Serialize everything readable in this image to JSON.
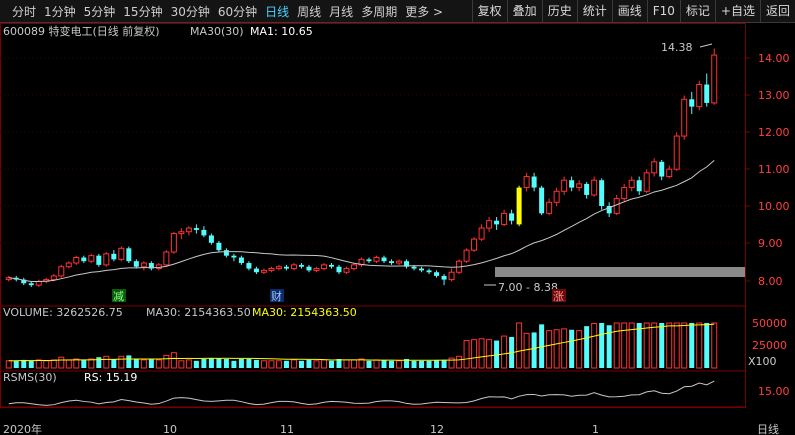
{
  "toolbar": {
    "periods": [
      "分时",
      "1分钟",
      "5分钟",
      "15分钟",
      "30分钟",
      "60分钟",
      "日线",
      "周线",
      "月线",
      "多周期",
      "更多 >"
    ],
    "active_period": "日线",
    "buttons": [
      "复权",
      "叠加",
      "历史",
      "统计",
      "画线",
      "F10",
      "标记",
      "+自选",
      "返回"
    ]
  },
  "stock": {
    "header": "600089 特变电工(日线 前复权)",
    "ma_label": "MA30(30)",
    "ma_value": "MA1: 10.65",
    "max_label": "14.38",
    "min_label": "7.00 - 8.38",
    "price_ticks": [
      "14.00",
      "13.00",
      "12.00",
      "11.00",
      "10.00",
      "9.00",
      "8.00"
    ]
  },
  "markers": {
    "reduce": "减",
    "finance": "财",
    "rise": "涨"
  },
  "volume": {
    "header": "VOLUME: 3262526.75",
    "ma30_1": "MA30: 2154363.50",
    "ma30_2": "MA30: 2154363.50",
    "ticks": [
      "50000",
      "25000"
    ],
    "unit": "X100"
  },
  "rsms": {
    "header": "RSMS(30)",
    "value": "RS: 15.19",
    "tick": "15.00"
  },
  "xaxis": {
    "labels": [
      "2020年",
      "10",
      "11",
      "12",
      "1"
    ],
    "right_label": "日线"
  },
  "colors": {
    "up": "#ff3232",
    "down": "#54fcfc",
    "highlight": "#ffff00",
    "ma": "#c8c8c8",
    "grid": "#7a0000"
  },
  "chart_data": {
    "type": "candlestick",
    "ylim": [
      7.6,
      14.8
    ],
    "candles": [
      [
        8.1,
        8.15,
        8.05,
        8.2
      ],
      [
        8.15,
        8.1,
        8.05,
        8.2
      ],
      [
        8.1,
        8.0,
        7.95,
        8.15
      ],
      [
        8.0,
        7.95,
        7.9,
        8.05
      ],
      [
        7.95,
        8.05,
        7.9,
        8.1
      ],
      [
        8.05,
        8.1,
        8.0,
        8.15
      ],
      [
        8.1,
        8.2,
        8.05,
        8.25
      ],
      [
        8.2,
        8.45,
        8.15,
        8.5
      ],
      [
        8.45,
        8.55,
        8.4,
        8.6
      ],
      [
        8.55,
        8.7,
        8.5,
        8.75
      ],
      [
        8.7,
        8.6,
        8.55,
        8.75
      ],
      [
        8.6,
        8.75,
        8.55,
        8.8
      ],
      [
        8.75,
        8.5,
        8.45,
        8.8
      ],
      [
        8.5,
        8.8,
        8.45,
        8.85
      ],
      [
        8.8,
        8.65,
        8.6,
        8.9
      ],
      [
        8.65,
        8.95,
        8.6,
        9.0
      ],
      [
        8.95,
        8.6,
        8.55,
        9.0
      ],
      [
        8.6,
        8.45,
        8.4,
        8.65
      ],
      [
        8.45,
        8.55,
        8.35,
        8.6
      ],
      [
        8.55,
        8.4,
        8.35,
        8.6
      ],
      [
        8.4,
        8.5,
        8.35,
        8.55
      ],
      [
        8.5,
        8.85,
        8.45,
        8.9
      ],
      [
        8.85,
        9.35,
        8.8,
        9.4
      ],
      [
        9.35,
        9.4,
        9.2,
        9.5
      ],
      [
        9.4,
        9.5,
        9.3,
        9.55
      ],
      [
        9.5,
        9.45,
        9.35,
        9.6
      ],
      [
        9.45,
        9.3,
        9.25,
        9.55
      ],
      [
        9.3,
        9.1,
        9.05,
        9.35
      ],
      [
        9.1,
        8.9,
        8.85,
        9.15
      ],
      [
        8.9,
        8.75,
        8.7,
        8.95
      ],
      [
        8.75,
        8.7,
        8.6,
        8.8
      ],
      [
        8.7,
        8.55,
        8.5,
        8.75
      ],
      [
        8.55,
        8.4,
        8.35,
        8.6
      ],
      [
        8.4,
        8.3,
        8.25,
        8.45
      ],
      [
        8.3,
        8.35,
        8.25,
        8.4
      ],
      [
        8.35,
        8.4,
        8.3,
        8.45
      ],
      [
        8.4,
        8.45,
        8.35,
        8.5
      ],
      [
        8.45,
        8.4,
        8.35,
        8.5
      ],
      [
        8.4,
        8.5,
        8.35,
        8.55
      ],
      [
        8.5,
        8.45,
        8.4,
        8.55
      ],
      [
        8.45,
        8.35,
        8.3,
        8.5
      ],
      [
        8.35,
        8.4,
        8.3,
        8.45
      ],
      [
        8.4,
        8.5,
        8.35,
        8.55
      ],
      [
        8.5,
        8.45,
        8.4,
        8.55
      ],
      [
        8.45,
        8.3,
        8.25,
        8.5
      ],
      [
        8.3,
        8.4,
        8.25,
        8.45
      ],
      [
        8.4,
        8.5,
        8.35,
        8.55
      ],
      [
        8.5,
        8.65,
        8.45,
        8.7
      ],
      [
        8.65,
        8.6,
        8.55,
        8.7
      ],
      [
        8.6,
        8.7,
        8.55,
        8.75
      ],
      [
        8.7,
        8.6,
        8.55,
        8.75
      ],
      [
        8.6,
        8.55,
        8.5,
        8.65
      ],
      [
        8.55,
        8.6,
        8.5,
        8.65
      ],
      [
        8.6,
        8.45,
        8.4,
        8.65
      ],
      [
        8.45,
        8.4,
        8.35,
        8.5
      ],
      [
        8.4,
        8.35,
        8.3,
        8.45
      ],
      [
        8.35,
        8.3,
        8.25,
        8.4
      ],
      [
        8.3,
        8.2,
        8.15,
        8.35
      ],
      [
        8.2,
        8.1,
        7.95,
        8.25
      ],
      [
        8.1,
        8.3,
        8.05,
        8.4
      ],
      [
        8.3,
        8.6,
        8.25,
        8.65
      ],
      [
        8.6,
        8.9,
        8.55,
        8.95
      ],
      [
        8.9,
        9.2,
        8.85,
        9.25
      ],
      [
        9.2,
        9.5,
        9.15,
        9.6
      ],
      [
        9.5,
        9.7,
        9.4,
        9.8
      ],
      [
        9.7,
        9.6,
        9.45,
        9.8
      ],
      [
        9.6,
        9.9,
        9.55,
        10.0
      ],
      [
        9.9,
        9.7,
        9.6,
        10.0
      ],
      [
        9.6,
        10.6,
        9.55,
        10.65
      ],
      [
        10.6,
        10.9,
        10.5,
        11.0
      ],
      [
        10.9,
        10.6,
        10.5,
        11.0
      ],
      [
        10.6,
        9.9,
        9.85,
        10.65
      ],
      [
        9.9,
        10.2,
        9.85,
        10.3
      ],
      [
        10.2,
        10.5,
        10.1,
        10.6
      ],
      [
        10.5,
        10.8,
        10.4,
        10.9
      ],
      [
        10.8,
        10.6,
        10.5,
        10.9
      ],
      [
        10.6,
        10.7,
        10.5,
        10.8
      ],
      [
        10.7,
        10.4,
        10.3,
        10.75
      ],
      [
        10.4,
        10.8,
        10.35,
        10.9
      ],
      [
        10.8,
        10.1,
        10.0,
        10.85
      ],
      [
        10.1,
        9.9,
        9.8,
        10.2
      ],
      [
        9.9,
        10.3,
        9.85,
        10.4
      ],
      [
        10.3,
        10.6,
        10.2,
        10.7
      ],
      [
        10.6,
        10.8,
        10.5,
        10.9
      ],
      [
        10.8,
        10.5,
        10.4,
        10.9
      ],
      [
        10.5,
        11.0,
        10.45,
        11.1
      ],
      [
        11.0,
        11.3,
        10.9,
        11.4
      ],
      [
        11.3,
        10.9,
        10.8,
        11.35
      ],
      [
        10.9,
        11.1,
        10.85,
        11.2
      ],
      [
        11.1,
        12.0,
        11.05,
        12.1
      ],
      [
        12.0,
        13.0,
        11.9,
        13.1
      ],
      [
        13.0,
        12.8,
        12.6,
        13.2
      ],
      [
        12.8,
        13.4,
        12.7,
        13.5
      ],
      [
        13.4,
        12.9,
        12.8,
        13.7
      ],
      [
        12.9,
        14.2,
        12.85,
        14.38
      ]
    ]
  }
}
